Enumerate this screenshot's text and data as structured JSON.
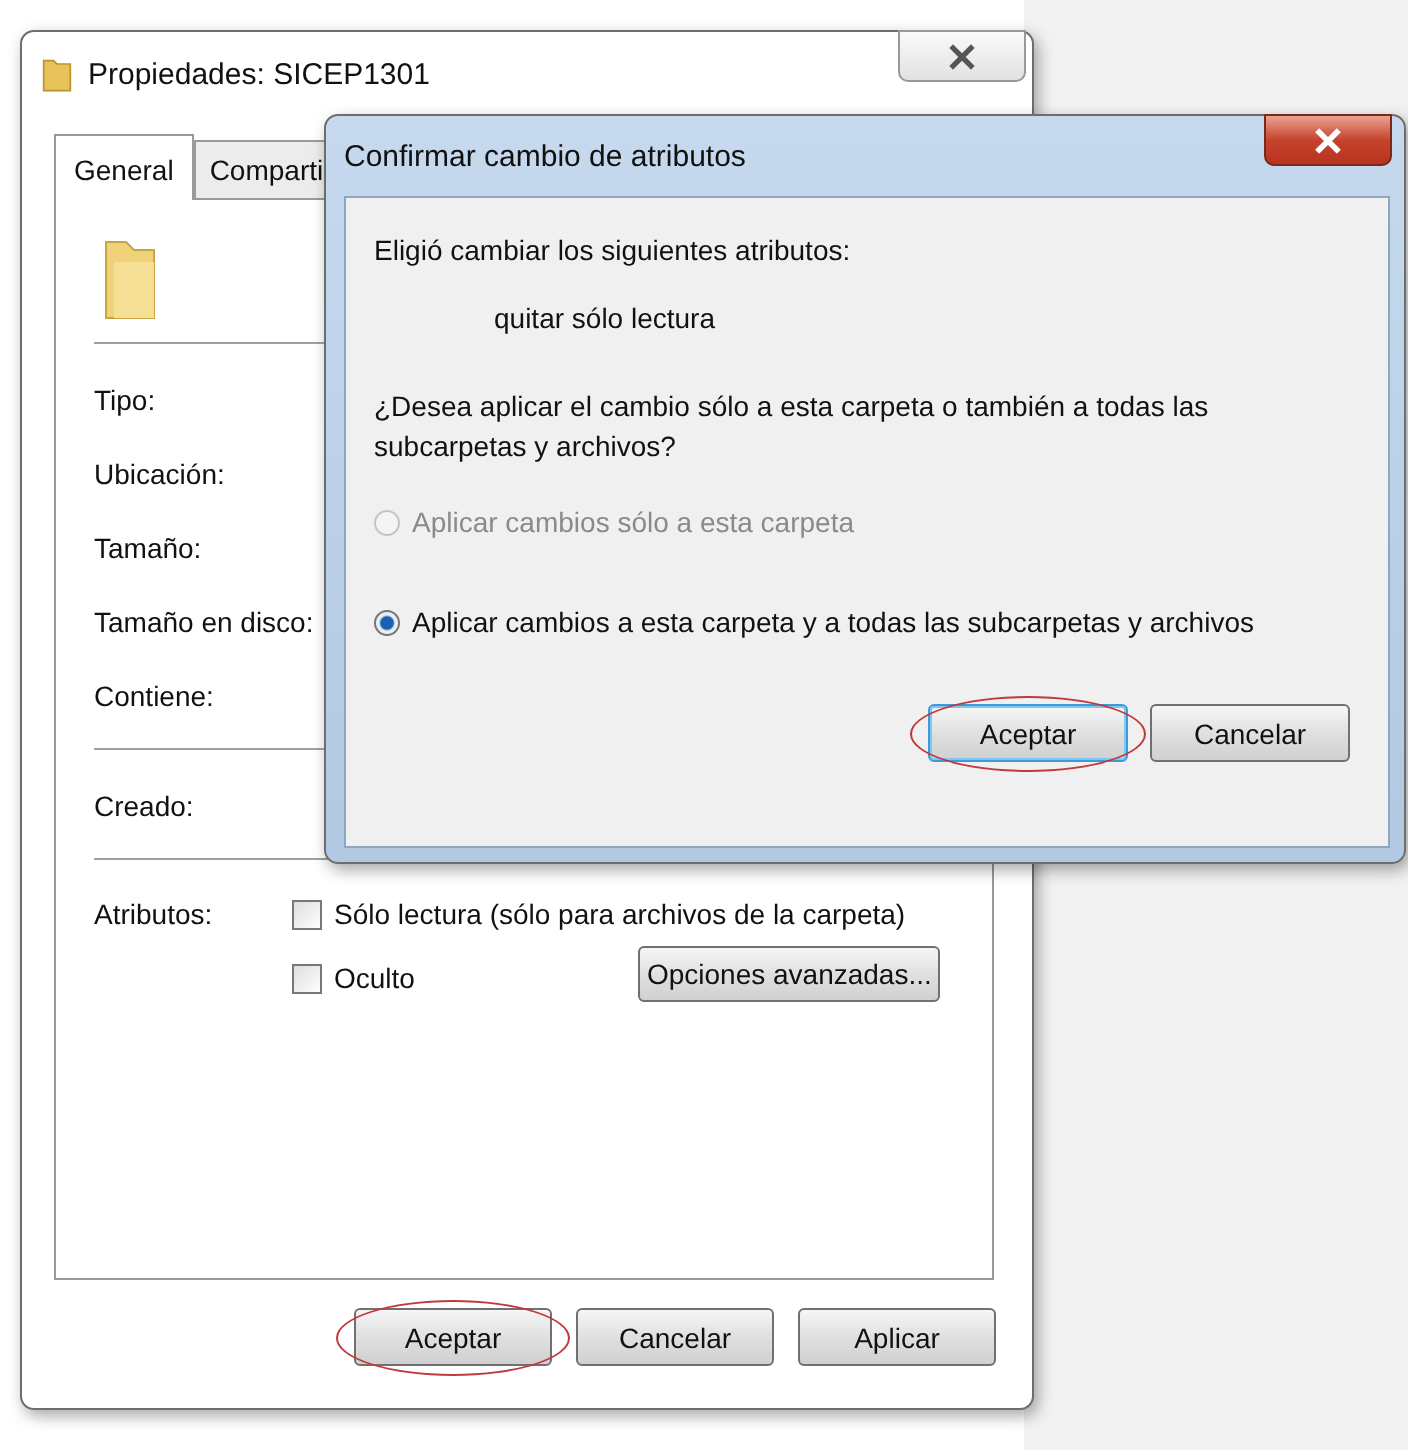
{
  "properties_window": {
    "title": "Propiedades: SICEP1301",
    "tabs": [
      {
        "label": "General",
        "selected": true
      },
      {
        "label": "Comparti",
        "selected": false
      }
    ],
    "info_sections": [
      {
        "labels": [
          "Tipo:",
          "Ubicación:",
          "Tamaño:",
          "Tamaño en disco:",
          "Contiene:"
        ]
      },
      {
        "labels": [
          "Creado:"
        ]
      }
    ],
    "attributes": {
      "label": "Atributos:",
      "checkboxes": [
        {
          "label": "Sólo lectura (sólo para archivos de la carpeta)",
          "checked": false
        },
        {
          "label": "Oculto",
          "checked": false
        }
      ],
      "advanced_button": "Opciones avanzadas..."
    },
    "buttons": [
      {
        "label": "Aceptar",
        "circled": true
      },
      {
        "label": "Cancelar",
        "circled": false
      },
      {
        "label": "Aplicar",
        "circled": false
      }
    ]
  },
  "dialog": {
    "title": "Confirmar cambio de atributos",
    "intro": "Eligió cambiar los siguientes atributos:",
    "change": "quitar sólo lectura",
    "question": "¿Desea aplicar el cambio sólo a esta carpeta o también a todas las subcarpetas y archivos?",
    "options": [
      {
        "label": "Aplicar cambios sólo a esta carpeta",
        "selected": false,
        "disabled": true
      },
      {
        "label": "Aplicar cambios a esta carpeta y a todas las subcarpetas y archivos",
        "selected": true,
        "disabled": false
      }
    ],
    "buttons": [
      {
        "label": "Aceptar",
        "circled": true,
        "default": true
      },
      {
        "label": "Cancelar",
        "circled": false,
        "default": false
      }
    ]
  }
}
